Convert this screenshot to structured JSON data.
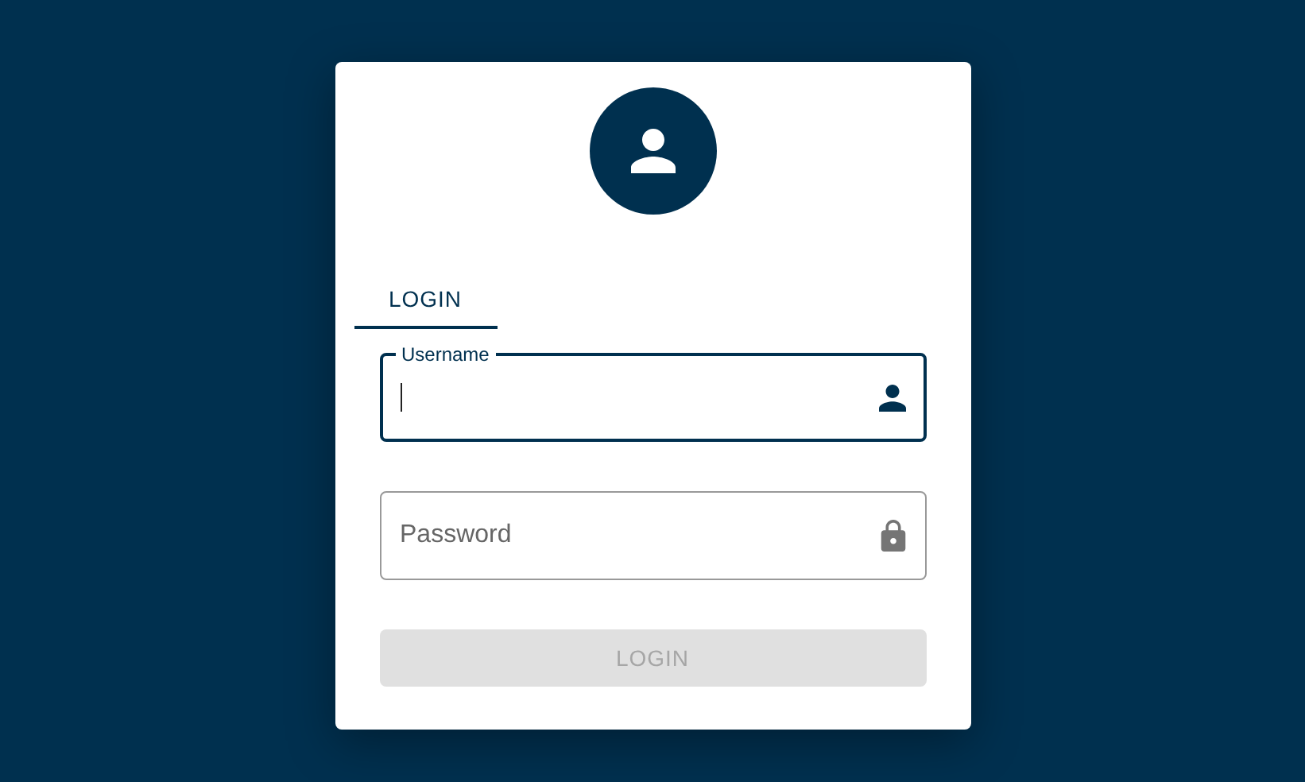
{
  "tabs": [
    {
      "label": "LOGIN",
      "selected": true
    }
  ],
  "fields": [
    {
      "kind": "username",
      "label": "Username",
      "focused": true
    },
    {
      "kind": "password",
      "label": "Password",
      "focused": false
    }
  ],
  "button": {
    "label": "LOGIN",
    "disabled": true
  }
}
